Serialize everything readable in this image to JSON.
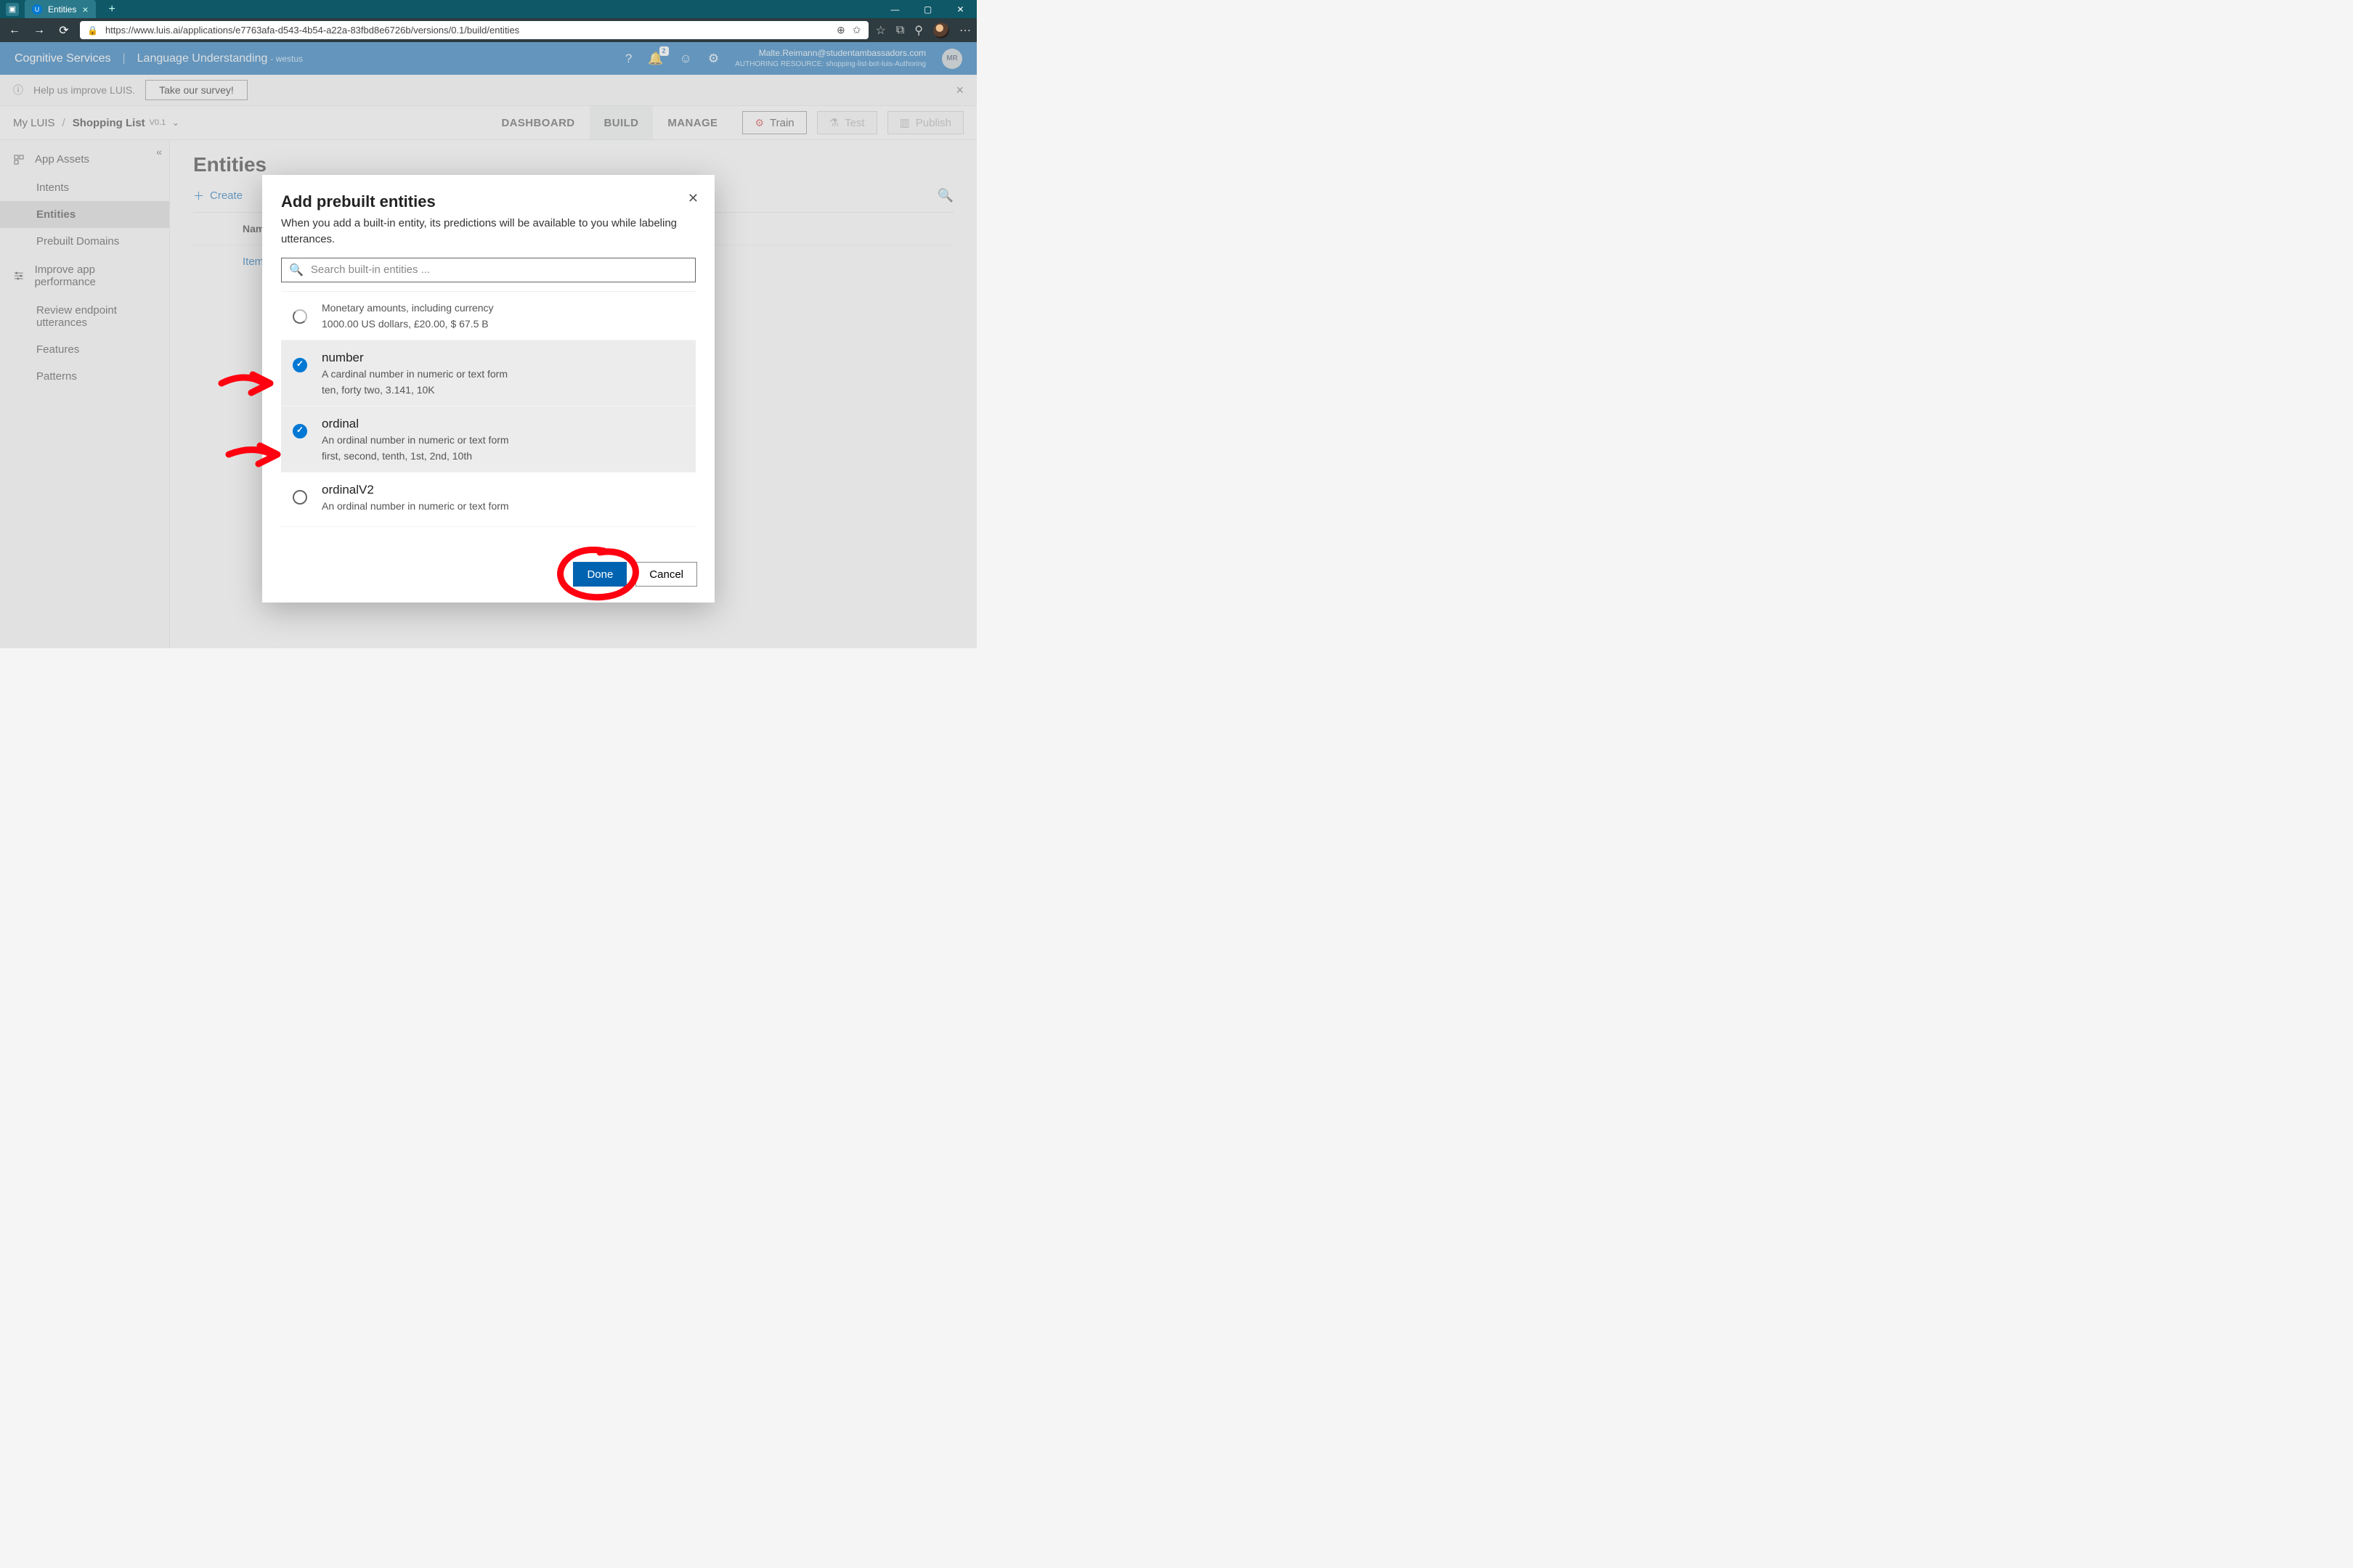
{
  "browser": {
    "tab_title": "Entities",
    "url": "https://www.luis.ai/applications/e7763afa-d543-4b54-a22a-83fbd8e6726b/versions/0.1/build/entities"
  },
  "header": {
    "brand": "Cognitive Services",
    "product": "Language Understanding",
    "region": "- westus",
    "bell_badge": "2",
    "user_email": "Malte.Reimann@studentambassadors.com",
    "resource_label": "AUTHORING RESOURCE:",
    "resource_value": "shopping-list-bot-luis-Authoring",
    "avatar_initials": "MR"
  },
  "survey": {
    "text": "Help us improve LUIS.",
    "button": "Take our survey!"
  },
  "breadcrumb": {
    "root": "My LUIS",
    "current": "Shopping List",
    "version": "V0.1"
  },
  "tabs": {
    "dashboard": "DASHBOARD",
    "build": "BUILD",
    "manage": "MANAGE"
  },
  "actions": {
    "train": "Train",
    "test": "Test",
    "publish": "Publish"
  },
  "sidebar": {
    "group1": "App Assets",
    "intents": "Intents",
    "entities": "Entities",
    "prebuilt": "Prebuilt Domains",
    "group2": "Improve app performance",
    "review": "Review endpoint utterances",
    "features": "Features",
    "patterns": "Patterns"
  },
  "main": {
    "title": "Entities",
    "create": "Create",
    "col_name": "Name",
    "first_row": "Item"
  },
  "modal": {
    "title": "Add prebuilt entities",
    "description": "When you add a built-in entity, its predictions will be available to you while labeling utterances.",
    "search_placeholder": "Search built-in entities ...",
    "done": "Done",
    "cancel": "Cancel",
    "entities": [
      {
        "name": "",
        "desc": "Monetary amounts, including currency",
        "ex": "1000.00 US dollars, £20.00, $ 67.5 B",
        "state": "loading"
      },
      {
        "name": "number",
        "desc": "A cardinal number in numeric or text form",
        "ex": "ten, forty two, 3.141, 10K",
        "state": "on"
      },
      {
        "name": "ordinal",
        "desc": "An ordinal number in numeric or text form",
        "ex": "first, second, tenth, 1st, 2nd, 10th",
        "state": "on"
      },
      {
        "name": "ordinalV2",
        "desc": "An ordinal number in numeric or text form",
        "ex": "",
        "state": "off"
      }
    ]
  }
}
